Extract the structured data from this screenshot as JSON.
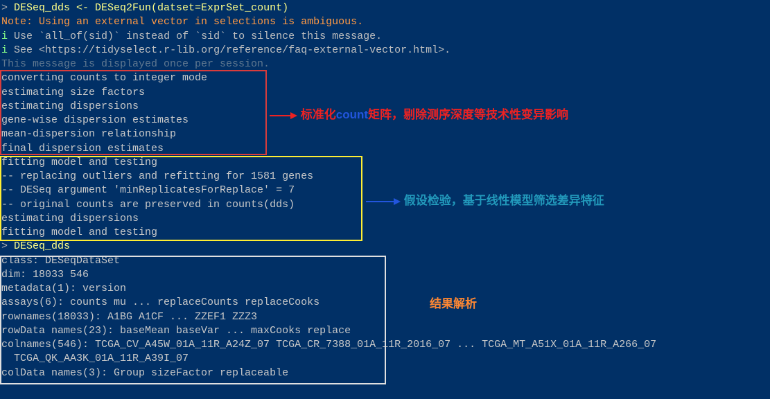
{
  "header": {
    "cmd_line": "> DESeq_dds <- DESeq2Fun(datset=ExprSet_count)",
    "note": "Note: Using an external vector in selections is ambiguous.",
    "tip1": "i Use `all_of(sid)` instead of `sid` to silence this message.",
    "tip2": "i See <https://tidyselect.r-lib.org/reference/faq-external-vector.html>.",
    "dim": "This message is displayed once per session."
  },
  "box1": {
    "lines": [
      "converting counts to integer mode",
      "estimating size factors",
      "estimating dispersions",
      "gene-wise dispersion estimates",
      "mean-dispersion relationship",
      "final dispersion estimates"
    ]
  },
  "box2": {
    "lines": [
      "fitting model and testing",
      "-- replacing outliers and refitting for 1581 genes",
      "-- DESeq argument 'minReplicatesForReplace' = 7",
      "-- original counts are preserved in counts(dds)",
      "estimating dispersions",
      "fitting model and testing"
    ]
  },
  "cmd2": "> DESeq_dds",
  "box3": {
    "lines": [
      "class: DESeqDataSet",
      "dim: 18033 546",
      "metadata(1): version",
      "assays(6): counts mu ... replaceCounts replaceCooks",
      "rownames(18033): A1BG A1CF ... ZZEF1 ZZZ3",
      "rowData names(23): baseMean baseVar ... maxCooks replace",
      "colnames(546): TCGA_CV_A45W_01A_11R_A24Z_07 TCGA_CR_7388_01A_11R_2016_07 ... TCGA_MT_A51X_01A_11R_A266_07",
      "  TCGA_QK_AA3K_01A_11R_A39I_07",
      "colData names(3): Group sizeFactor replaceable"
    ]
  },
  "annotations": {
    "a1_prefix": "标准化",
    "a1_count": "count",
    "a1_suffix": "矩阵，剔除测序深度等技术性变异影响",
    "a2": "假设检验，基于线性模型筛选差异特征",
    "a3": "结果解析"
  }
}
